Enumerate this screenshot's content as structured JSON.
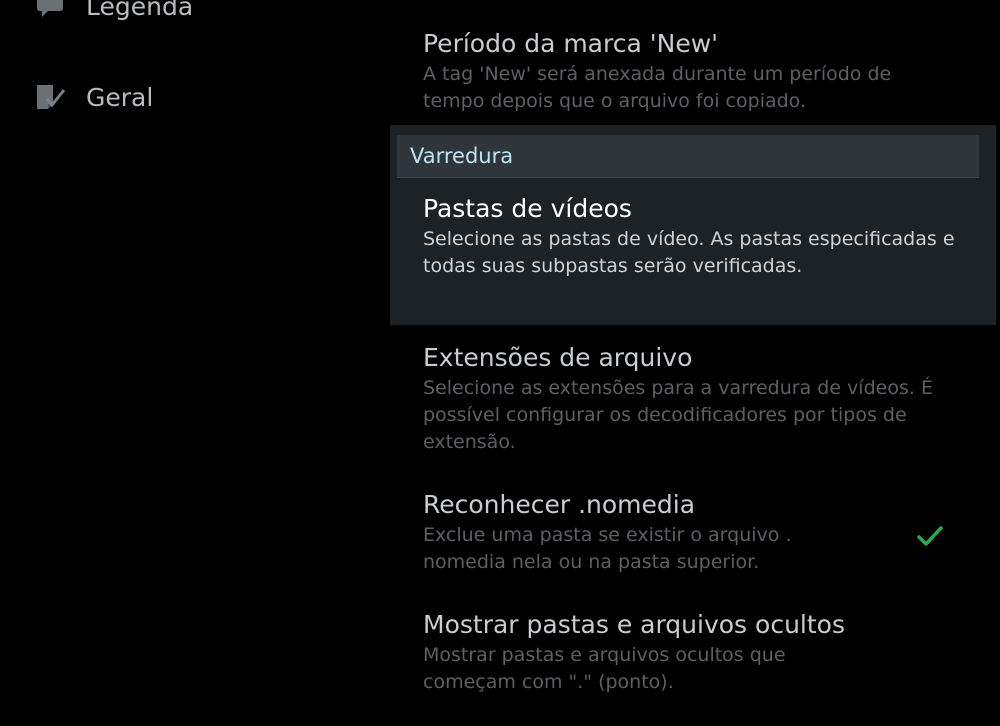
{
  "sidebar": {
    "items": [
      {
        "label": "Legenda",
        "icon": "chat-bubble-icon"
      },
      {
        "label": "Geral",
        "icon": "note-check-icon"
      }
    ]
  },
  "settings": {
    "new_mark_period": {
      "title": "Período da marca 'New'",
      "desc": "A tag 'New' será anexada durante um período de tempo depois que o arquivo foi copiado."
    },
    "section_header": "Varredura",
    "video_folders": {
      "title": "Pastas de vídeos",
      "desc": "Selecione as pastas de vídeo. As pastas especificadas e todas suas subpastas serão verificadas."
    },
    "file_extensions": {
      "title": "Extensões de arquivo",
      "desc": "Selecione as extensões para a varredura de vídeos. É possível configurar os decodificadores por tipos de extensão."
    },
    "recognize_nomedia": {
      "title": "Reconhecer .nomedia",
      "desc": "Exclue uma pasta se existir o arquivo . nomedia nela ou na pasta superior.",
      "checked": true
    },
    "show_hidden": {
      "title": "Mostrar pastas e arquivos ocultos",
      "desc": "Mostrar pastas e arquivos ocultos que começam com \".\" (ponto).",
      "checked": false
    }
  },
  "colors": {
    "background": "#000000",
    "focus_panel": "#1d2226",
    "section_header": "#2e353b",
    "section_header_text": "#bfe4f7",
    "check_green": "#2fa84a"
  }
}
